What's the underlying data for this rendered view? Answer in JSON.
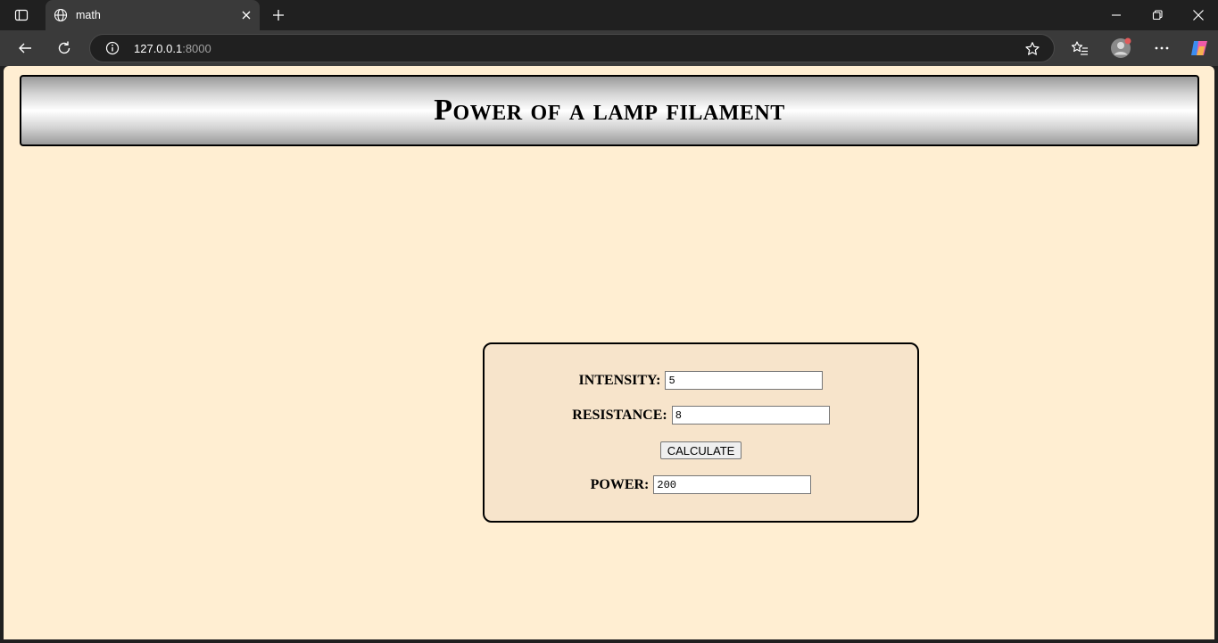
{
  "browser": {
    "tab_title": "math",
    "url_host": "127.0.0.1",
    "url_port": ":8000"
  },
  "page": {
    "heading": "Power of a lamp filament"
  },
  "form": {
    "intensity_label": "INTENSITY:",
    "intensity_value": "5",
    "resistance_label": "RESISTANCE:",
    "resistance_value": "8",
    "calculate_label": "CALCULATE",
    "power_label": "POWER:",
    "power_value": "200"
  },
  "colors": {
    "page_background": "#ffeed2",
    "form_background": "#f7e4cb",
    "chrome_dark": "#202020",
    "chrome_toolbar": "#3a3a3a"
  },
  "icons": [
    "tab-actions-icon",
    "globe-icon",
    "close-icon",
    "plus-icon",
    "minimize-icon",
    "restore-icon",
    "back-icon",
    "refresh-icon",
    "info-icon",
    "star-icon",
    "favorites-icon",
    "profile-icon",
    "more-icon",
    "copilot-icon"
  ]
}
